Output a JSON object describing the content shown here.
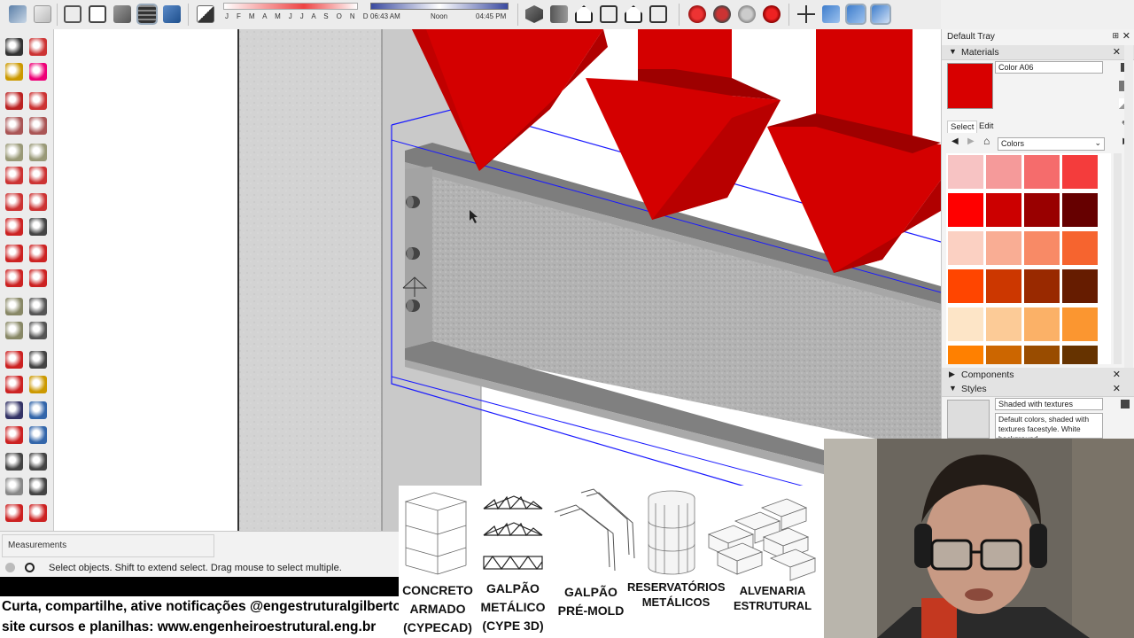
{
  "toolbar": {
    "icons": [
      "component-icon",
      "eraser-3d-icon",
      "wireframe-icon",
      "hidden-line-icon",
      "shaded-icon",
      "shaded-textures-icon",
      "monochrome-icon",
      "xray-icon",
      "shadows-toggle-icon",
      "iso-view-icon",
      "top-view-icon",
      "front-view-icon",
      "right-view-icon",
      "back-view-icon",
      "left-view-icon",
      "warehouse-icon",
      "share-model-icon",
      "extension-icon",
      "ruby-icon",
      "axes-icon",
      "section-plane-icon",
      "section-fill-icon",
      "section-cut-icon"
    ],
    "months": "J F M A M J J A S O N D",
    "time_start": "06:43 AM",
    "time_noon": "Noon",
    "time_end": "04:45 PM"
  },
  "left_tools": [
    "select-icon",
    "make-component-icon",
    "paint-bucket-icon",
    "eraser-icon",
    "pencil-icon",
    "freehand-icon",
    "rectangle-icon",
    "rotated-rectangle-icon",
    "circle-icon",
    "polygon-icon",
    "arc-icon",
    "pie-icon",
    "two-point-arc-icon",
    "three-point-arc-icon",
    "move-icon",
    "push-pull-icon",
    "rotate-icon",
    "follow-me-icon",
    "scale-icon",
    "offset-icon",
    "tape-measure-icon",
    "dimension-icon",
    "protractor-icon",
    "text-icon",
    "axes-icon",
    "3d-text-icon",
    "orbit-icon",
    "pan-icon",
    "zoom-icon",
    "zoom-window-icon",
    "zoom-extents-icon",
    "previous-view-icon",
    "position-camera-icon",
    "look-around-icon",
    "walk-icon",
    "section-plane-icon",
    "sandbox-icon",
    "warehouse-icon"
  ],
  "viewport": {
    "description_visible": "",
    "colors": {
      "beam_gray": "#a9a9a9",
      "flange": "#7b7b7b",
      "arrow_red": "#d40000",
      "arrow_dark": "#8f0000",
      "selection_blue": "#1a1aff",
      "wall": "#d5d5d5"
    }
  },
  "measurements": {
    "label": "Measurements"
  },
  "status": {
    "text": "Select objects. Shift to extend select. Drag mouse to select multiple."
  },
  "promo": {
    "line1": "Curta, compartilhe, ative notificações @engestruturalgilberto",
    "line2": "site cursos e planilhas: www.engenheiroestrutural.eng.br"
  },
  "courses": [
    {
      "icon": "concrete-building-icon",
      "label_1": "CONCRETO",
      "label_2": "ARMADO",
      "label_3": "(CYPECAD)"
    },
    {
      "icon": "steel-truss-icon",
      "label_1": "GALPÃO",
      "label_2": "METÁLICO",
      "label_3": "(CYPE 3D)"
    },
    {
      "icon": "precast-frame-icon",
      "label_1": "GALPÃO",
      "label_2": "PRÉ-MOLD",
      "label_3": ""
    },
    {
      "icon": "steel-tank-icon",
      "label_1": "RESERVATÓRIOS",
      "label_2": "METÁLICOS",
      "label_3": ""
    },
    {
      "icon": "masonry-blocks-icon",
      "label_1": "ALVENARIA",
      "label_2": "ESTRUTURAL",
      "label_3": ""
    }
  ],
  "tray": {
    "title": "Default Tray",
    "materials": {
      "header": "Materials",
      "name": "Color A06",
      "tab_select": "Select",
      "tab_edit": "Edit",
      "library": "Colors",
      "current_color": "#d80000",
      "swatches": [
        "#f7c3c3",
        "#f59a9a",
        "#f56c6c",
        "#f43c3c",
        "#ff0000",
        "#cc0000",
        "#990000",
        "#660000",
        "#fbd0c2",
        "#f9ad94",
        "#f88a66",
        "#f6642f",
        "#ff4500",
        "#cc3700",
        "#992900",
        "#661c00",
        "#fde5c7",
        "#fccb97",
        "#fbb167",
        "#fb9630",
        "#ff8000",
        "#cc6600",
        "#994c00",
        "#663300"
      ]
    },
    "components": {
      "header": "Components"
    },
    "styles": {
      "header": "Styles",
      "name": "Shaded with textures",
      "description": "Default colors, shaded with textures facestyle. White background."
    }
  }
}
